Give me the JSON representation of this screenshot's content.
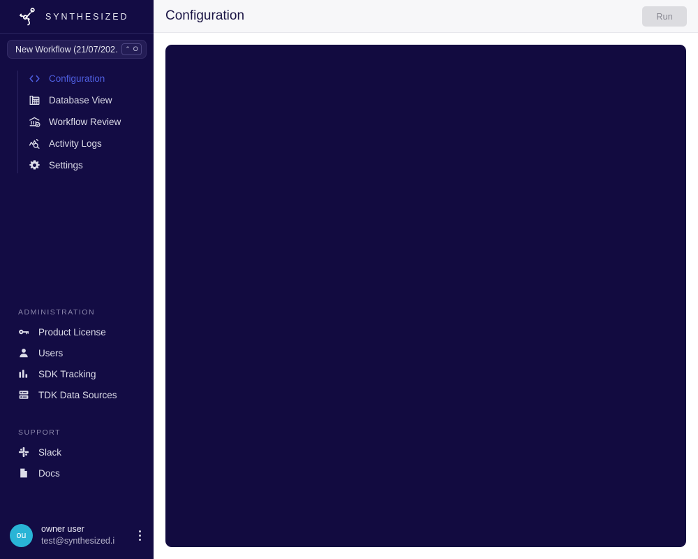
{
  "brand": {
    "name": "SYNTHESIZED",
    "logo_icon": "synthesized-network-logo",
    "accent_color": "#4f5fe2",
    "sidebar_color": "#130c44",
    "canvas_color": "#120b40",
    "avatar_color": "#29b4d6"
  },
  "workflow_selector": {
    "label": "New Workflow (21/07/202…",
    "shortcut_modifier": "⌃",
    "shortcut_key": "O"
  },
  "nav": {
    "items": [
      {
        "label": "Configuration",
        "icon": "code-brackets-icon",
        "active": true
      },
      {
        "label": "Database View",
        "icon": "database-grid-icon",
        "active": false
      },
      {
        "label": "Workflow Review",
        "icon": "bank-check-icon",
        "active": false
      },
      {
        "label": "Activity Logs",
        "icon": "chart-search-icon",
        "active": false
      },
      {
        "label": "Settings",
        "icon": "gear-icon",
        "active": false
      }
    ]
  },
  "administration": {
    "title": "ADMINISTRATION",
    "items": [
      {
        "label": "Product License",
        "icon": "key-icon"
      },
      {
        "label": "Users",
        "icon": "person-icon"
      },
      {
        "label": "SDK Tracking",
        "icon": "bar-chart-icon"
      },
      {
        "label": "TDK Data Sources",
        "icon": "server-icon"
      }
    ]
  },
  "support": {
    "title": "SUPPORT",
    "items": [
      {
        "label": "Slack",
        "icon": "slack-icon"
      },
      {
        "label": "Docs",
        "icon": "document-icon"
      }
    ]
  },
  "user": {
    "initials": "ou",
    "name": "owner user",
    "email": "test@synthesized.i",
    "menu_icon": "vertical-dots-icon"
  },
  "header": {
    "title": "Configuration",
    "run_label": "Run",
    "run_disabled": true
  },
  "canvas": {
    "content": ""
  }
}
